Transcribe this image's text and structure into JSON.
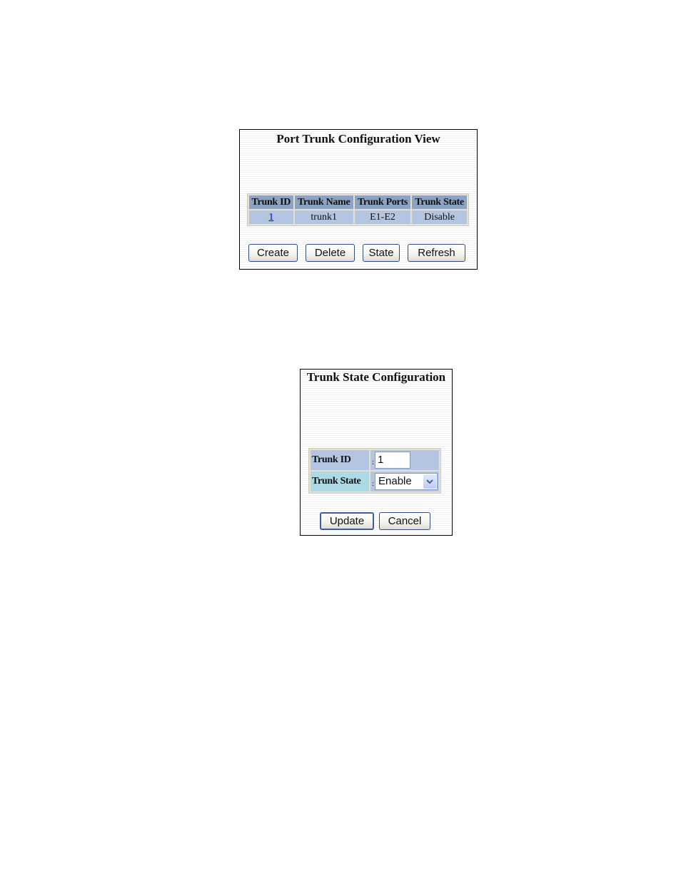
{
  "trunk_view": {
    "title": "Port Trunk Configuration View",
    "columns": [
      "Trunk ID",
      "Trunk Name",
      "Trunk Ports",
      "Trunk State"
    ],
    "rows": [
      {
        "trunk_id": "1",
        "trunk_name": "trunk1",
        "trunk_ports": "E1-E2",
        "trunk_state": "Disable"
      }
    ],
    "buttons": {
      "create": "Create",
      "delete": "Delete",
      "state": "State",
      "refresh": "Refresh"
    }
  },
  "trunk_state_config": {
    "title": "Trunk State Configuration",
    "fields": {
      "trunk_id_label": "Trunk ID",
      "trunk_id_value": "1",
      "trunk_state_label": "Trunk State",
      "trunk_state_value": "Enable",
      "separator": ":"
    },
    "buttons": {
      "update": "Update",
      "cancel": "Cancel"
    }
  },
  "icons": {
    "dropdown": "chevron-down-icon"
  },
  "colors": {
    "header_bg": "#8ba3c6",
    "row_bg": "#b3c5e0",
    "label_alt_bg": "#abd9e6",
    "link": "#0000ee",
    "button_border": "#2f4f7a"
  }
}
